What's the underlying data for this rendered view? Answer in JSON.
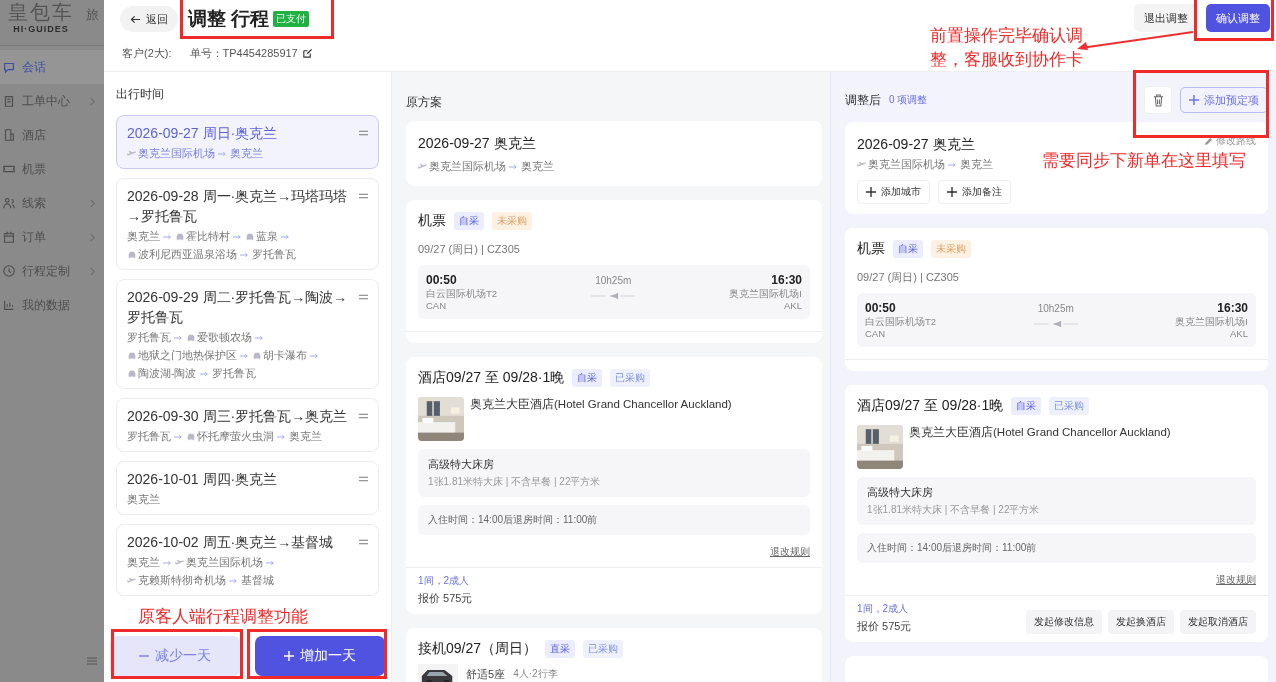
{
  "sidebar": {
    "logo": "皇包车",
    "logo_subtitle": "HI·GUIDES",
    "cut_tab": "旅",
    "items": [
      {
        "label": "会话",
        "selected": true,
        "expandable": false
      },
      {
        "label": "工单中心",
        "selected": false,
        "expandable": true
      },
      {
        "label": "酒店",
        "selected": false,
        "expandable": false
      },
      {
        "label": "机票",
        "selected": false,
        "expandable": false
      },
      {
        "label": "线索",
        "selected": false,
        "expandable": true
      },
      {
        "label": "订单",
        "selected": false,
        "expandable": true
      },
      {
        "label": "行程定制",
        "selected": false,
        "expandable": true
      },
      {
        "label": "我的数据",
        "selected": false,
        "expandable": false
      }
    ]
  },
  "header": {
    "back": "返回",
    "title": "调整 行程",
    "badge": "已支付",
    "customer": "客户(2大):",
    "order_no": "单号：TP4454285917",
    "buttons": [
      {
        "label": "退出调整",
        "kind": "secondary"
      },
      {
        "label": "确认调整",
        "kind": "primary"
      }
    ]
  },
  "itinerary": {
    "heading": "出行时间",
    "days": [
      {
        "title": "2026-09-27 周日·奥克兰",
        "selected": true,
        "route": [
          {
            "kind": "plane",
            "name": "奥克兰国际机场"
          },
          {
            "kind": "city",
            "name": "奥克兰"
          }
        ]
      },
      {
        "title": "2026-09-28 周一·奥克兰→玛塔玛塔→罗托鲁瓦",
        "selected": false,
        "route": [
          {
            "kind": "city",
            "name": "奥克兰"
          },
          {
            "kind": "car",
            "name": "霍比特村"
          },
          {
            "kind": "car",
            "name": "蓝泉"
          },
          {
            "kind": "car",
            "name": "波利尼西亚温泉浴场"
          },
          {
            "kind": "city",
            "name": "罗托鲁瓦"
          }
        ]
      },
      {
        "title": "2026-09-29 周二·罗托鲁瓦→陶波→罗托鲁瓦",
        "selected": false,
        "route": [
          {
            "kind": "city",
            "name": "罗托鲁瓦"
          },
          {
            "kind": "car",
            "name": "爱歌顿农场"
          },
          {
            "kind": "car",
            "name": "地狱之门地热保护区"
          },
          {
            "kind": "car",
            "name": "胡卡瀑布"
          },
          {
            "kind": "car",
            "name": "陶波湖-陶波"
          },
          {
            "kind": "city",
            "name": "罗托鲁瓦"
          }
        ]
      },
      {
        "title": "2026-09-30 周三·罗托鲁瓦→奥克兰",
        "selected": false,
        "route": [
          {
            "kind": "city",
            "name": "罗托鲁瓦"
          },
          {
            "kind": "car",
            "name": "怀托摩萤火虫洞"
          },
          {
            "kind": "city",
            "name": "奥克兰"
          }
        ]
      },
      {
        "title": "2026-10-01 周四·奥克兰",
        "selected": false,
        "route": [
          {
            "kind": "city",
            "name": "奥克兰"
          }
        ]
      },
      {
        "title": "2026-10-02 周五·奥克兰→基督城",
        "selected": false,
        "route": [
          {
            "kind": "city",
            "name": "奥克兰"
          },
          {
            "kind": "plane",
            "name": "奥克兰国际机场"
          },
          {
            "kind": "plane",
            "name": "克赖斯特彻奇机场"
          },
          {
            "kind": "city",
            "name": "基督城"
          }
        ]
      }
    ],
    "buttons": [
      {
        "label": "减少一天",
        "kind": "remove"
      },
      {
        "label": "增加一天",
        "kind": "add"
      }
    ]
  },
  "original_plan": {
    "heading": "原方案",
    "day": {
      "title": "2026-09-27 奥克兰",
      "route": [
        {
          "kind": "plane",
          "name": "奥克兰国际机场"
        },
        {
          "kind": "city",
          "name": "奥克兰"
        }
      ]
    },
    "flight": {
      "title": "机票",
      "tags": [
        {
          "label": "自采",
          "kind": "source"
        },
        {
          "label": "未采购",
          "kind": "pending"
        }
      ],
      "info": "09/27 (周日) | CZ305",
      "depart": {
        "time": "00:50",
        "airport": "白云国际机场T2",
        "code": "CAN"
      },
      "duration": "10h25m",
      "arrive": {
        "time": "16:30",
        "airport": "奥克兰国际机场I",
        "code": "AKL"
      }
    },
    "hotel": {
      "title": "酒店09/27 至 09/28·1晚",
      "tags": [
        {
          "label": "自采",
          "kind": "source"
        },
        {
          "label": "已采购",
          "kind": "done"
        }
      ],
      "name": "奥克兰大臣酒店(Hotel Grand Chancellor Auckland)",
      "room": "高级特大床房",
      "room_details": "1张1.81米特大床 | 不含早餐 | 22平方米",
      "check_times": "入住时间：14:00后退房时间：11:00前",
      "rules_link": "退改规则",
      "guests": "1间，2成人",
      "price": "报价 575元"
    },
    "transfer": {
      "title": "接机09/27（周日）",
      "tags": [
        {
          "label": "直采",
          "kind": "source"
        },
        {
          "label": "已采购",
          "kind": "done"
        }
      ],
      "vehicle": "舒适5座",
      "capacity": "4人·2行李"
    }
  },
  "adjusted_plan": {
    "heading": "调整后",
    "count": "0 项调整",
    "add_button": "添加预定项",
    "day": {
      "title": "2026-09-27 奥克兰",
      "edit": "修改路线",
      "route": [
        {
          "kind": "plane",
          "name": "奥克兰国际机场"
        },
        {
          "kind": "city",
          "name": "奥克兰"
        }
      ],
      "buttons": [
        "添加城市",
        "添加备注"
      ]
    },
    "flight": {
      "title": "机票",
      "tags": [
        {
          "label": "自采",
          "kind": "source"
        },
        {
          "label": "未采购",
          "kind": "pending"
        }
      ],
      "info": "09/27 (周日) | CZ305",
      "depart": {
        "time": "00:50",
        "airport": "白云国际机场T2",
        "code": "CAN"
      },
      "duration": "10h25m",
      "arrive": {
        "time": "16:30",
        "airport": "奥克兰国际机场I",
        "code": "AKL"
      }
    },
    "hotel": {
      "title": "酒店09/27 至 09/28·1晚",
      "tags": [
        {
          "label": "自采",
          "kind": "source"
        },
        {
          "label": "已采购",
          "kind": "done"
        }
      ],
      "name": "奥克兰大臣酒店(Hotel Grand Chancellor Auckland)",
      "room": "高级特大床房",
      "room_details": "1张1.81米特大床 | 不含早餐 | 22平方米",
      "check_times": "入住时间：14:00后退房时间：11:00前",
      "rules_link": "退改规则",
      "guests": "1间，2成人",
      "price": "报价 575元",
      "actions": [
        "发起修改信息",
        "发起换酒店",
        "发起取消酒店"
      ]
    }
  },
  "annotations": [
    {
      "text": "前置操作完毕确认调整，客服收到协作卡"
    },
    {
      "text": "需要同步下新单在这里填写"
    },
    {
      "text": "原客人端行程调整功能"
    }
  ]
}
